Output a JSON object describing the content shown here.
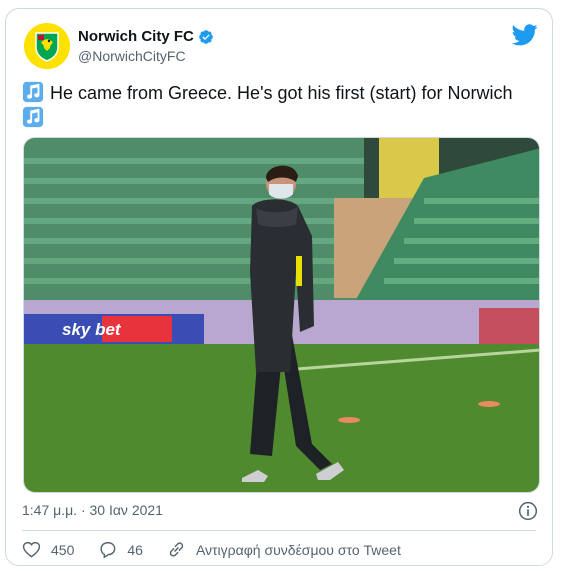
{
  "account": {
    "display_name": "Norwich City FC",
    "handle": "@NorwichCityFC",
    "verified": true
  },
  "tweet": {
    "text": "He came from Greece. He's got his first (start) for Norwich",
    "timestamp": "1:47 μ.μ. · 30 Ιαν 2021"
  },
  "media": {
    "ad_board_text": "sky bet"
  },
  "actions": {
    "like_count": "450",
    "reply_count": "46",
    "copy_link_label": "Αντιγραφή συνδέσμου στο Tweet"
  },
  "colors": {
    "brand_blue": "#1d9bf0",
    "text_secondary": "#536471",
    "border": "#cfd9de",
    "club_yellow": "#ffe100",
    "club_green": "#00a650"
  },
  "icons": [
    "norwich-city-crest-icon",
    "verified-badge-icon",
    "twitter-bird-icon",
    "music-note-icon",
    "info-icon",
    "heart-icon",
    "reply-icon",
    "link-icon"
  ]
}
